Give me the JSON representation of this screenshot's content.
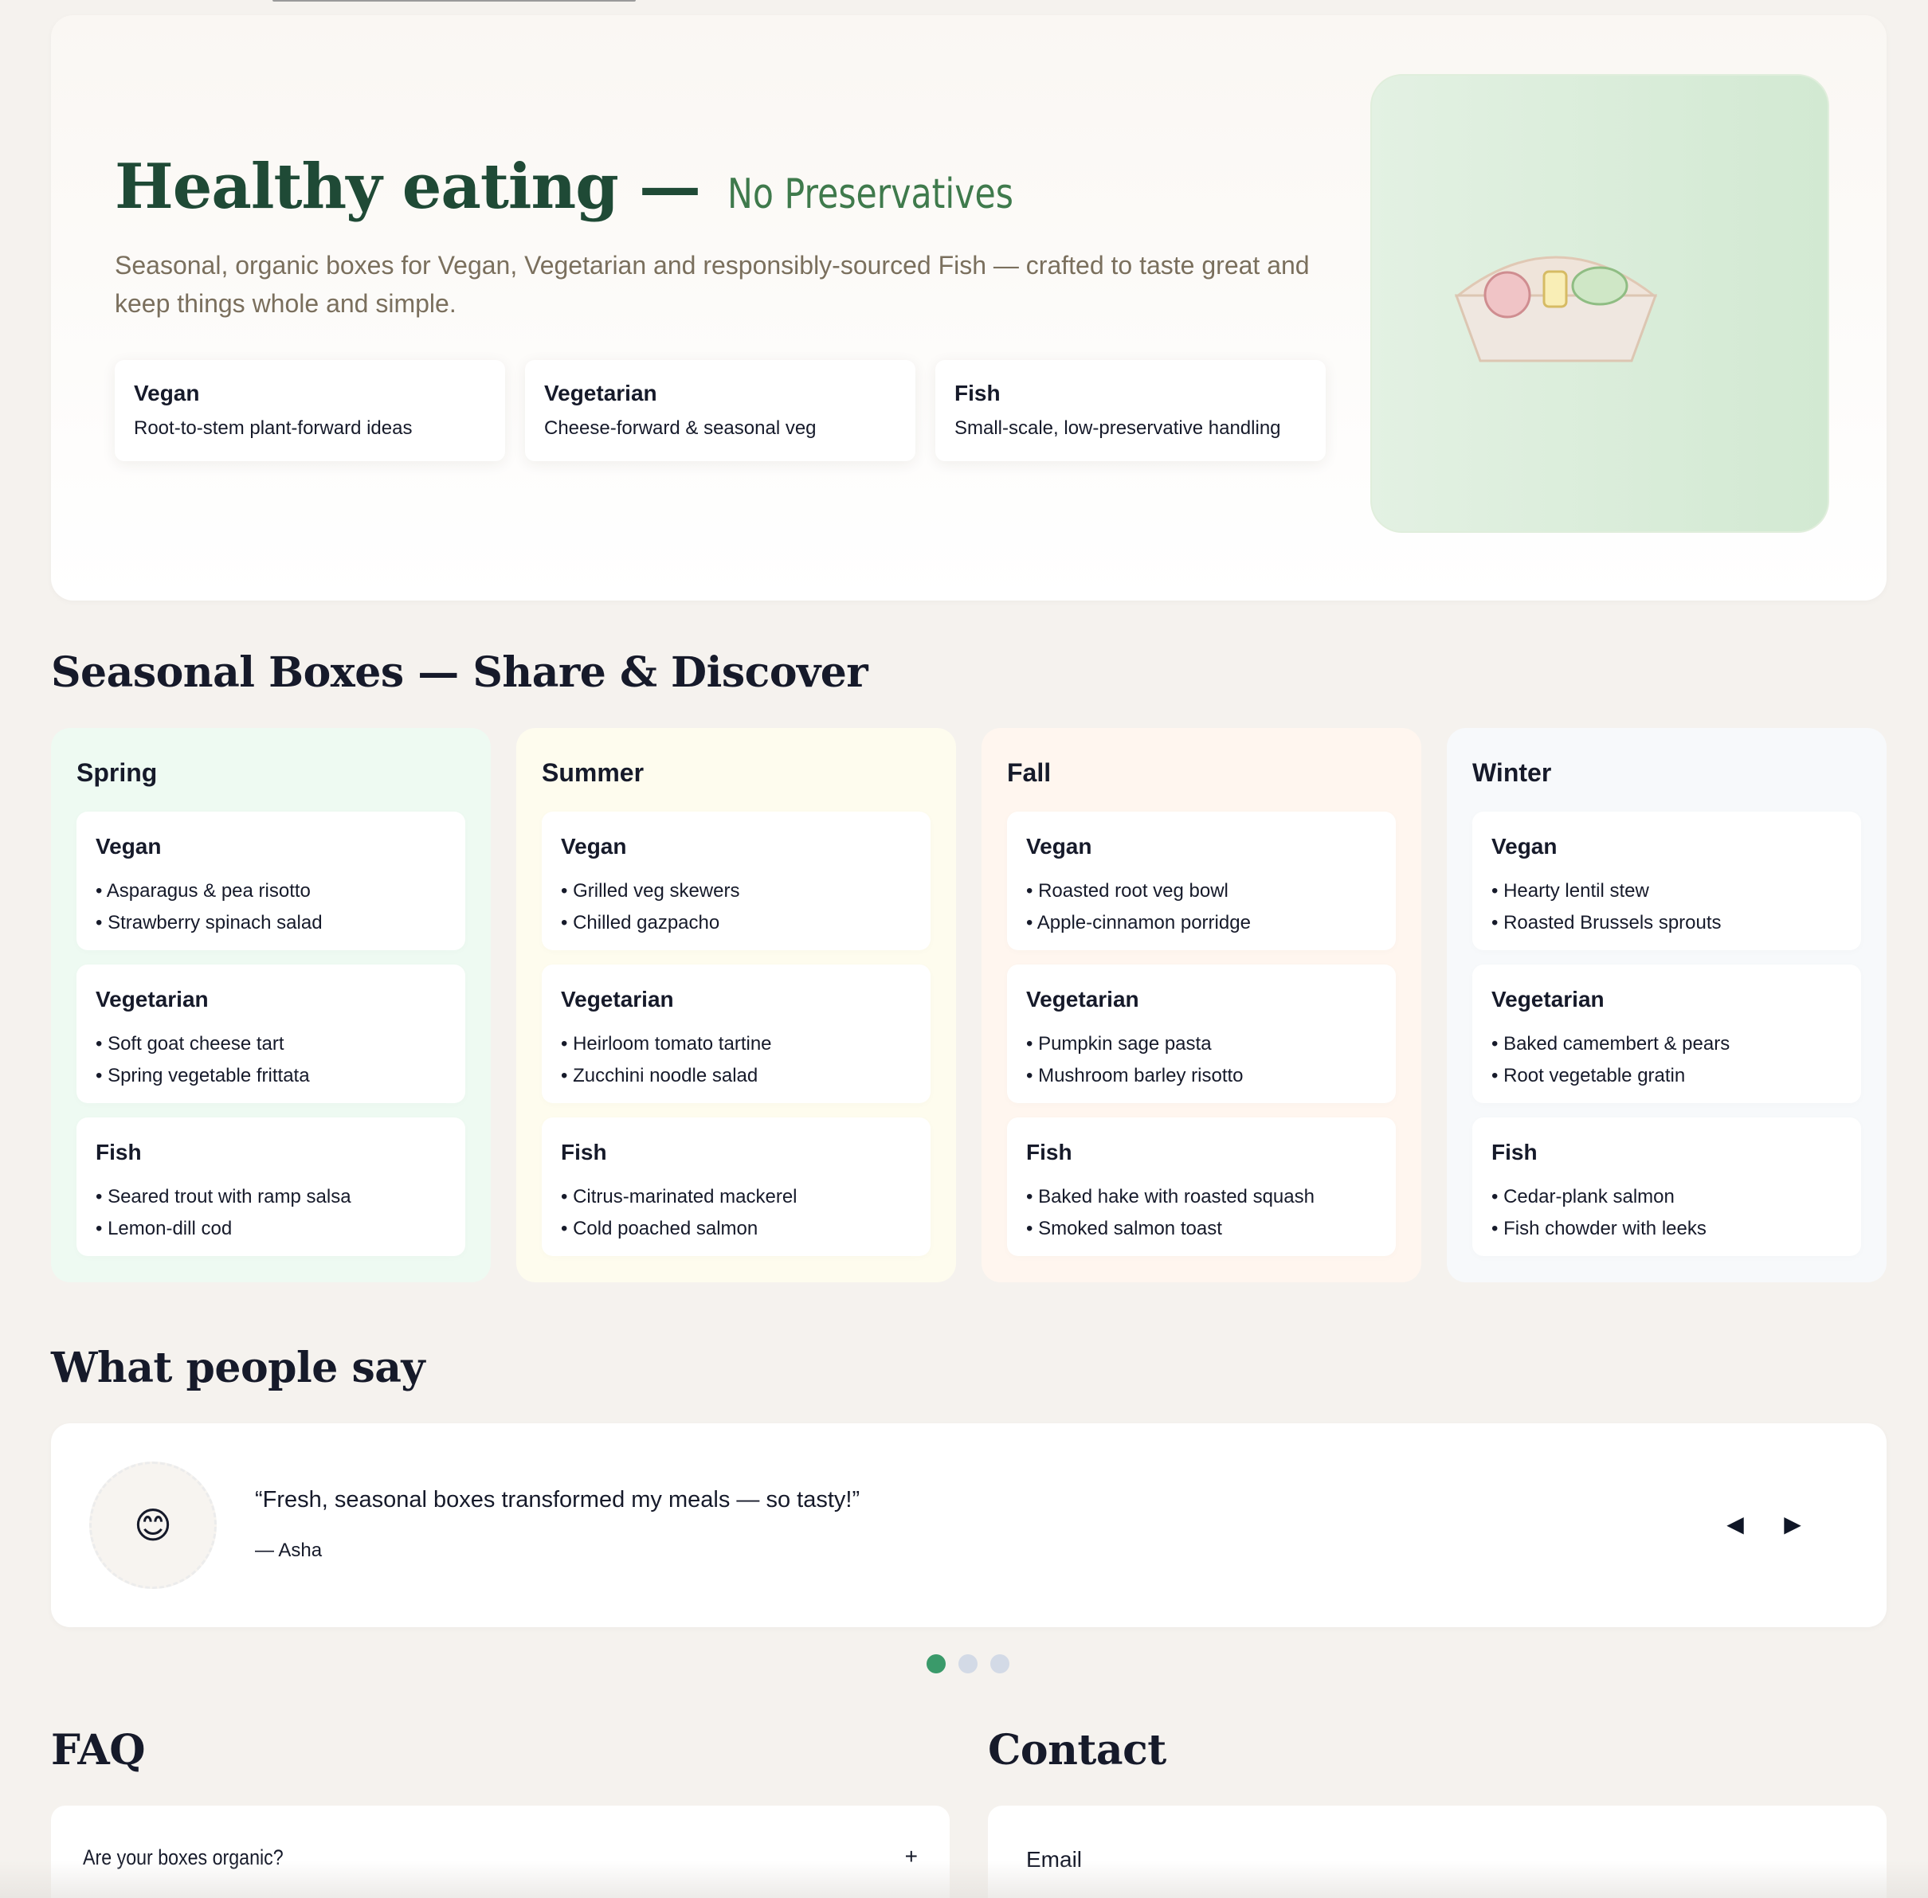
{
  "hero": {
    "title": "Healthy eating —",
    "tagline": "No Preservatives",
    "subtitle": "Seasonal, organic boxes for Vegan, Vegetarian and responsibly-sourced Fish — crafted to taste great and keep things whole and simple.",
    "cards": [
      {
        "title": "Vegan",
        "desc": "Root-to-stem plant-forward ideas"
      },
      {
        "title": "Vegetarian",
        "desc": "Cheese-forward & seasonal veg"
      },
      {
        "title": "Fish",
        "desc": "Small-scale, low-preservative handling"
      }
    ],
    "image_icon": "food-bowl-illustration"
  },
  "seasons_section": {
    "title": "Seasonal Boxes — Share & Discover",
    "seasons": [
      {
        "name": "Spring",
        "color": "#eefaf2",
        "boxes": [
          {
            "title": "Vegan",
            "items": [
              "Asparagus & pea risotto",
              "Strawberry spinach salad"
            ]
          },
          {
            "title": "Vegetarian",
            "items": [
              "Soft goat cheese tart",
              "Spring vegetable frittata"
            ]
          },
          {
            "title": "Fish",
            "items": [
              "Seared trout with ramp salsa",
              "Lemon-dill cod"
            ]
          }
        ]
      },
      {
        "name": "Summer",
        "color": "#fefcee",
        "boxes": [
          {
            "title": "Vegan",
            "items": [
              "Grilled veg skewers",
              "Chilled gazpacho"
            ]
          },
          {
            "title": "Vegetarian",
            "items": [
              "Heirloom tomato tartine",
              "Zucchini noodle salad"
            ]
          },
          {
            "title": "Fish",
            "items": [
              "Citrus-marinated mackerel",
              "Cold poached salmon"
            ]
          }
        ]
      },
      {
        "name": "Fall",
        "color": "#fff6ef",
        "boxes": [
          {
            "title": "Vegan",
            "items": [
              "Roasted root veg bowl",
              "Apple-cinnamon porridge"
            ]
          },
          {
            "title": "Vegetarian",
            "items": [
              "Pumpkin sage pasta",
              "Mushroom barley risotto"
            ]
          },
          {
            "title": "Fish",
            "items": [
              "Baked hake with roasted squash",
              "Smoked salmon toast"
            ]
          }
        ]
      },
      {
        "name": "Winter",
        "color": "#f7f9fb",
        "boxes": [
          {
            "title": "Vegan",
            "items": [
              "Hearty lentil stew",
              "Roasted Brussels sprouts"
            ]
          },
          {
            "title": "Vegetarian",
            "items": [
              "Baked camembert & pears",
              "Root vegetable gratin"
            ]
          },
          {
            "title": "Fish",
            "items": [
              "Cedar-plank salmon",
              "Fish chowder with leeks"
            ]
          }
        ]
      }
    ]
  },
  "testimonials": {
    "title": "What people say",
    "avatar": "😊",
    "quote": "“Fresh, seasonal boxes transformed my meals — so tasty!”",
    "author": "— Asha",
    "prev_label": "◀",
    "next_label": "▶",
    "dot_count": 3,
    "active_dot": 0
  },
  "faq": {
    "title": "FAQ",
    "items": [
      {
        "question": "Are your boxes organic?",
        "toggle": "+"
      }
    ]
  },
  "contact": {
    "title": "Contact",
    "email_label": "Email"
  }
}
